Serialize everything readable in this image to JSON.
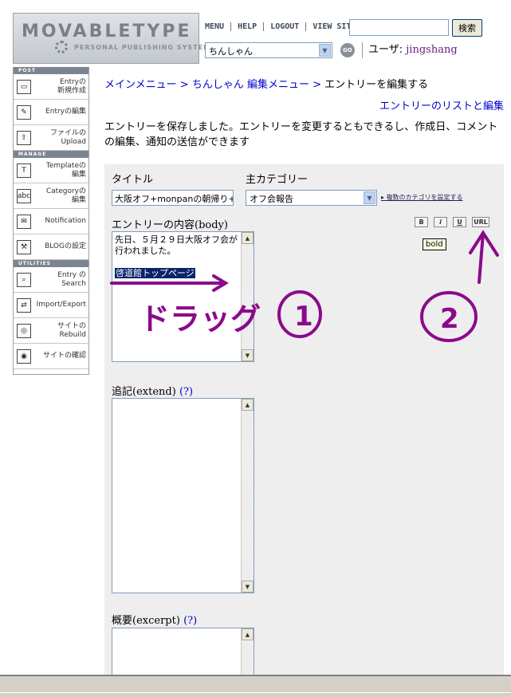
{
  "header": {
    "logo_text": "MOVABLETYPE",
    "logo_tagline": "PERSONAL PUBLISHING SYSTEM",
    "nav": [
      "MENU",
      "HELP",
      "LOGOUT",
      "VIEW SITE"
    ],
    "search_button": "検索",
    "blog_select_value": "ちんしゃん",
    "go_label": "GO",
    "user_label": "ユーザ:",
    "user_name": "jingshang"
  },
  "sidebar": {
    "sections": {
      "post": "POST",
      "manage": "MANAGE",
      "utilities": "UTILITIES"
    },
    "items": [
      {
        "label": "Entryの\n新規作成",
        "icon": "new-entry-icon"
      },
      {
        "label": "Entryの編集",
        "icon": "edit-entry-icon"
      },
      {
        "label": "ファイルの\nUpload",
        "icon": "upload-icon"
      },
      {
        "label": "Templateの\n編集",
        "icon": "template-icon"
      },
      {
        "label": "Categoryの\n編集",
        "icon": "category-icon"
      },
      {
        "label": "Notification",
        "icon": "mail-icon"
      },
      {
        "label": "BLOGの設定",
        "icon": "tools-icon"
      },
      {
        "label": "Entry の\nSearch",
        "icon": "search-icon"
      },
      {
        "label": "Import/Export",
        "icon": "import-export-icon"
      },
      {
        "label": "サイトの\nRebuild",
        "icon": "rebuild-icon"
      },
      {
        "label": "サイトの確認",
        "icon": "view-site-icon"
      }
    ]
  },
  "breadcrumb": {
    "main_menu": "メインメニュー",
    "sep": ">",
    "blog_menu": "ちんしゃん 編集メニュー",
    "current": "エントリーを編集する"
  },
  "list_link": "エントリーのリストと編集",
  "message": "エントリーを保存しました。エントリーを変更するともできるし、作成日、コメントの編集、通知の送信ができます",
  "form": {
    "title_label": "タイトル",
    "title_value": "大阪オフ+monpanの朝帰り+",
    "category_label": "主カテゴリー",
    "category_value": "オフ会報告",
    "multi_category_link": "複数のカテゴリを設定する",
    "body_label_ja": "エントリーの内容",
    "body_label_en": "(body)",
    "body_text": "先日、５月２９日大阪オフ会が行われました。",
    "body_selected": "啓道館トップページ",
    "format_buttons": [
      "B",
      "i",
      "U",
      "URL"
    ],
    "bold_tooltip": "bold",
    "extended_label_ja": "追記",
    "extended_label_en": "(extend)",
    "excerpt_label_ja": "概要",
    "excerpt_label_en": "(excerpt)",
    "help_link": "(?)"
  },
  "annotations": {
    "drag_text": "ドラッグ",
    "step1": "①",
    "step2": "②",
    "ink_color": "#8b0a8b"
  }
}
